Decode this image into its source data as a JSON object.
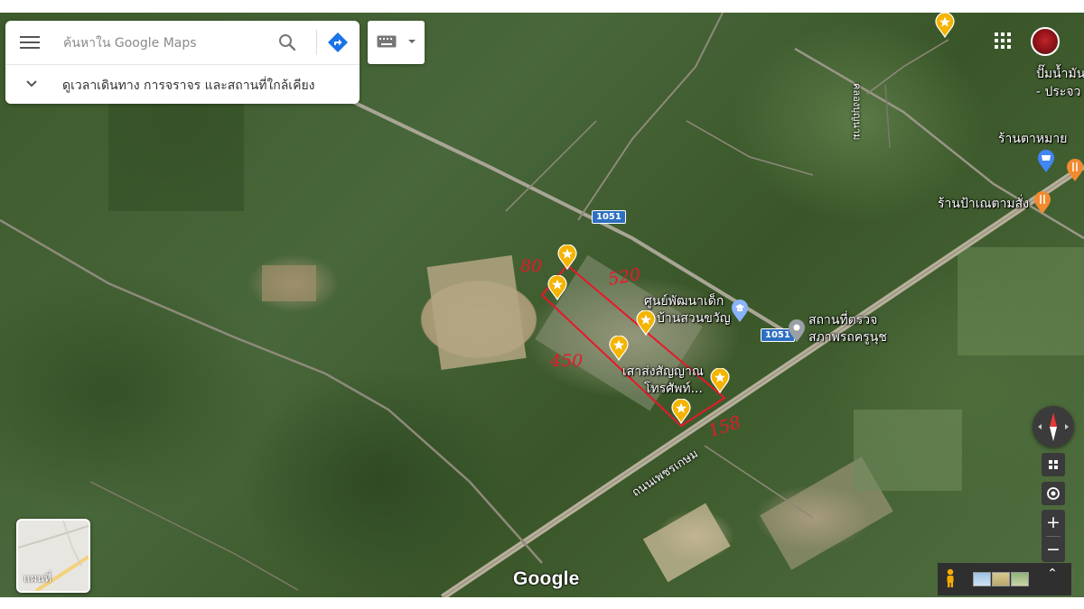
{
  "search": {
    "placeholder": "ค้นหาใน Google Maps",
    "nearby_text": "ดูเวลาเดินทาง การจราจร และสถานที่ใกล้เคียง"
  },
  "map": {
    "route_shields": [
      "1051",
      "1051"
    ],
    "places": {
      "ban_nam_man": "ปั๊มน้ำมัน",
      "ban_nam_man_sub": "- ประจว",
      "ran_ta_mai": "ร้านตาหมาย",
      "ran_pa_net": "ร้านป้าเณตามสั่ง",
      "child_center_1": "ศูนย์พัฒนาเด็ก",
      "child_center_2": "บ้านสวนขวัญ",
      "inspection_1": "สถานที่ตรวจ",
      "inspection_2": "สภาพรถครูนุช",
      "signal_tower_1": "เสาส่งสัญญาณ",
      "signal_tower_2": "โทรศัพท์...",
      "canal": "คลองบุญนาม",
      "highway": "ถนนเพชรเกษม"
    },
    "annotations": {
      "top_left": "80",
      "top_right": "520",
      "left": "450",
      "bottom_right": "158"
    }
  },
  "controls": {
    "layer_label": "แผนที่",
    "zoom_in": "+",
    "zoom_out": "−",
    "expand": "⌃"
  },
  "branding": {
    "logo": "Google"
  },
  "colors": {
    "annotation_red": "#e8182a",
    "pin_yellow": "#f4b400",
    "route_blue": "#2d6fc0",
    "directions_blue": "#1a73e8"
  }
}
